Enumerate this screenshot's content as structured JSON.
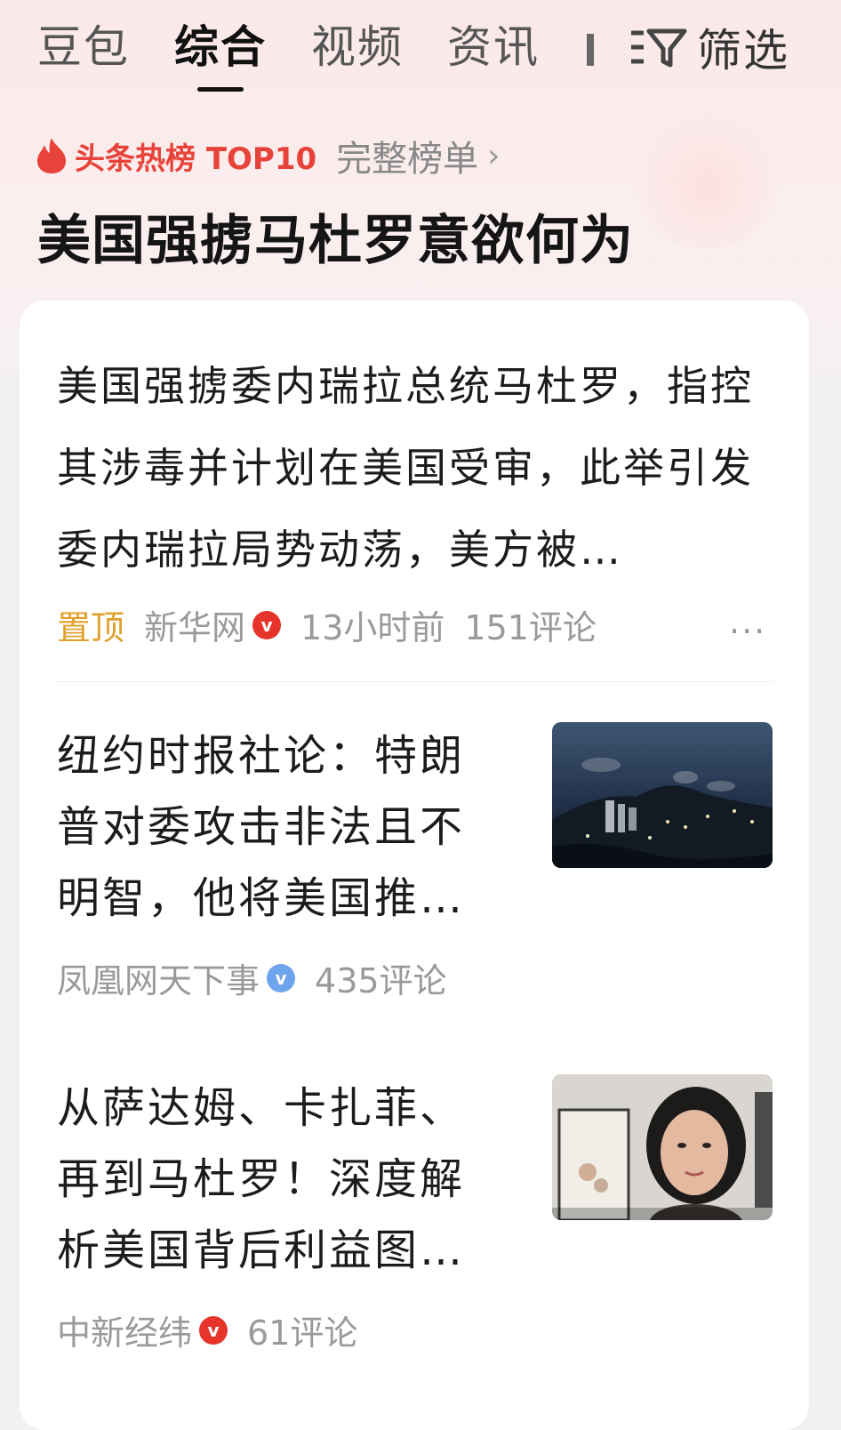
{
  "tabs": [
    {
      "label": "豆包"
    },
    {
      "label": "综合",
      "active": true
    },
    {
      "label": "视频"
    },
    {
      "label": "资讯"
    }
  ],
  "filter": {
    "label": "筛选",
    "icon": "filter-icon"
  },
  "hot": {
    "label": "头条热榜 TOP10",
    "full_list": "完整榜单",
    "chevron": "›",
    "headline": "美国强掳马杜罗意欲何为"
  },
  "articles": [
    {
      "title": "美国强掳委内瑞拉总统马杜罗，指控其涉毒并计划在美国受审，此举引发委内瑞拉局势动荡，美方被…",
      "pinned_label": "置顶",
      "source": "新华网",
      "verified": "red",
      "time": "13小时前",
      "comments": "151评论",
      "more": "···"
    },
    {
      "title": "纽约时报社论：特朗普对委攻击非法且不明智，他将美国推…",
      "source": "凤凰网天下事",
      "verified": "blue",
      "comments": "435评论",
      "thumb": "night-city-smoke"
    },
    {
      "title": "从萨达姆、卡扎菲、再到马杜罗！深度解析美国背后利益图…",
      "source": "中新经纬",
      "verified": "red",
      "comments": "61评论",
      "thumb": "woman-speaking-video"
    }
  ],
  "colors": {
    "accent_red": "#e8433a",
    "pinned": "#e0a02a",
    "badge_blue": "#6ea4ee",
    "text_primary": "#1c1c1c",
    "text_meta": "#9a9a9a"
  }
}
